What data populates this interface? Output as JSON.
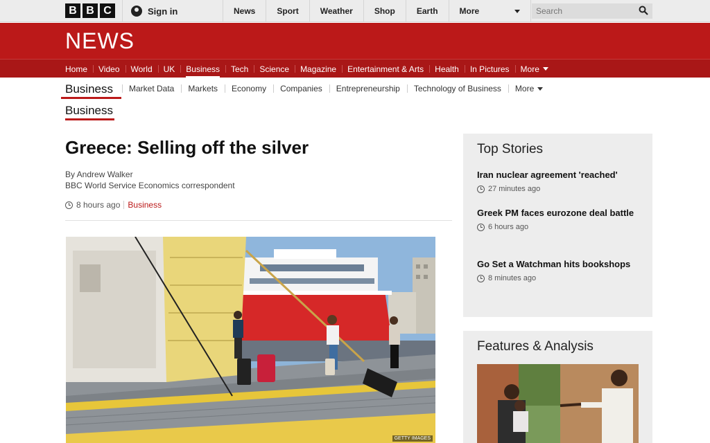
{
  "topbar": {
    "logo_letters": [
      "B",
      "B",
      "C"
    ],
    "sign_in": "Sign in",
    "nav": [
      "News",
      "Sport",
      "Weather",
      "Shop",
      "Earth"
    ],
    "more": "More",
    "search_placeholder": "Search"
  },
  "news": {
    "logo": "NEWS",
    "nav": [
      "Home",
      "Video",
      "World",
      "UK",
      "Business",
      "Tech",
      "Science",
      "Magazine",
      "Entertainment & Arts",
      "Health",
      "In Pictures"
    ],
    "active": "Business",
    "more": "More"
  },
  "subnav": {
    "title": "Business",
    "items": [
      "Market Data",
      "Markets",
      "Economy",
      "Companies",
      "Entrepreneurship",
      "Technology of Business"
    ],
    "more": "More"
  },
  "section_label": "Business",
  "article": {
    "headline": "Greece: Selling off the silver",
    "author": "By Andrew Walker",
    "role": "BBC World Service Economics correspondent",
    "time": "8 hours ago",
    "category": "Business",
    "image_credit": "GETTY IMAGES"
  },
  "top_stories": {
    "heading": "Top Stories",
    "items": [
      {
        "title": "Iran nuclear agreement 'reached'",
        "time": "27 minutes ago"
      },
      {
        "title": "Greek PM faces eurozone deal battle",
        "time": "6 hours ago"
      },
      {
        "title": "Go Set a Watchman hits bookshops",
        "time": "8 minutes ago"
      }
    ]
  },
  "features": {
    "heading": "Features & Analysis"
  },
  "colors": {
    "brand_red": "#bb1919",
    "nav_red": "#a91717",
    "sidebar_bg": "#ededed"
  }
}
